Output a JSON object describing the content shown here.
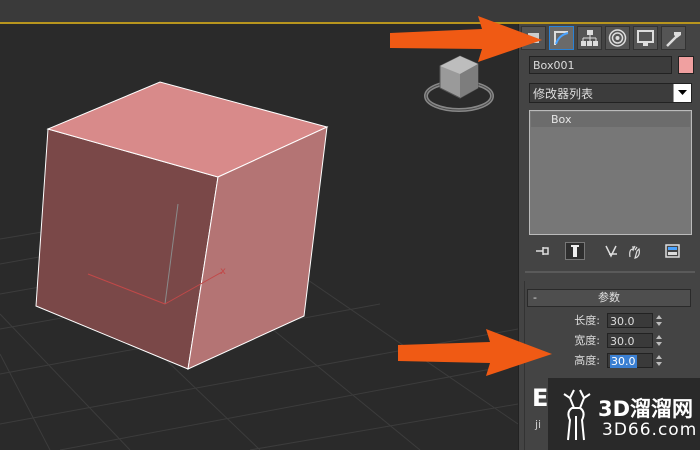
{
  "panel": {
    "tabs": [
      {
        "name": "create-tab",
        "icon": "create-icon"
      },
      {
        "name": "modify-tab",
        "icon": "modify-icon",
        "active": true
      },
      {
        "name": "hierarchy-tab",
        "icon": "hierarchy-icon"
      },
      {
        "name": "motion-tab",
        "icon": "motion-icon"
      },
      {
        "name": "display-tab",
        "icon": "display-icon"
      },
      {
        "name": "utilities-tab",
        "icon": "hammer-icon"
      }
    ],
    "object_name": "Box001",
    "object_color": "#f0a0a0",
    "modifier_list_label": "修改器列表",
    "stack_items": [
      "Box"
    ],
    "stack_icons": [
      "pin-stack-icon",
      "show-end-result-icon",
      "make-unique-icon",
      "remove-modifier-icon",
      "configure-sets-icon"
    ]
  },
  "params": {
    "rollout_collapse": "-",
    "rollout_title": "参数",
    "length_label": "长度:",
    "length_value": "30.0",
    "width_label": "宽度:",
    "width_value": "30.0",
    "height_label": "高度:",
    "height_value": "30.0"
  },
  "viewport": {
    "box_color": "#d88a8a",
    "axis_x_label": "x"
  },
  "annotation_arrow_color": "#f05a14",
  "watermark": {
    "title": "3D溜溜网",
    "subtitle": "3D66.com",
    "partial_letter": "E",
    "partial_tail": "ji"
  }
}
